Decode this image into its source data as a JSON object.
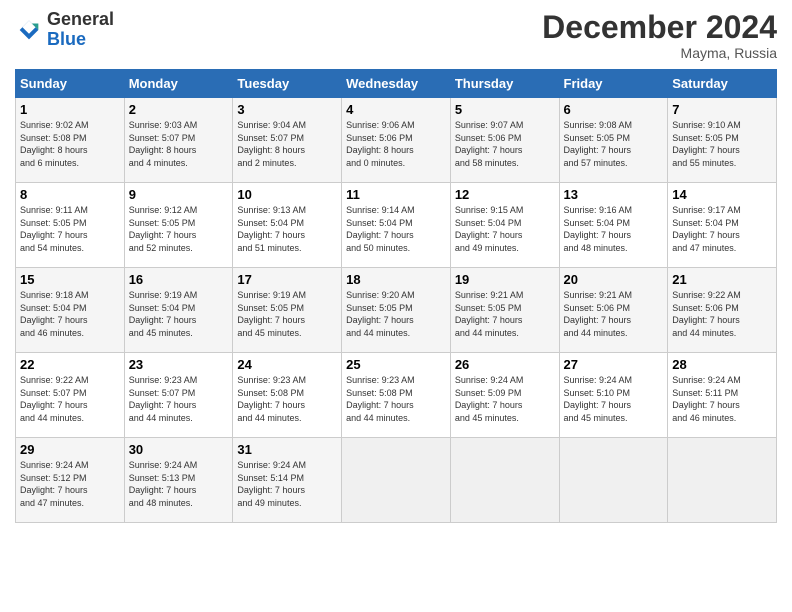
{
  "header": {
    "logo_general": "General",
    "logo_blue": "Blue",
    "month_title": "December 2024",
    "subtitle": "Mayma, Russia"
  },
  "days_of_week": [
    "Sunday",
    "Monday",
    "Tuesday",
    "Wednesday",
    "Thursday",
    "Friday",
    "Saturday"
  ],
  "weeks": [
    [
      {
        "day": "1",
        "info": "Sunrise: 9:02 AM\nSunset: 5:08 PM\nDaylight: 8 hours\nand 6 minutes."
      },
      {
        "day": "2",
        "info": "Sunrise: 9:03 AM\nSunset: 5:07 PM\nDaylight: 8 hours\nand 4 minutes."
      },
      {
        "day": "3",
        "info": "Sunrise: 9:04 AM\nSunset: 5:07 PM\nDaylight: 8 hours\nand 2 minutes."
      },
      {
        "day": "4",
        "info": "Sunrise: 9:06 AM\nSunset: 5:06 PM\nDaylight: 8 hours\nand 0 minutes."
      },
      {
        "day": "5",
        "info": "Sunrise: 9:07 AM\nSunset: 5:06 PM\nDaylight: 7 hours\nand 58 minutes."
      },
      {
        "day": "6",
        "info": "Sunrise: 9:08 AM\nSunset: 5:05 PM\nDaylight: 7 hours\nand 57 minutes."
      },
      {
        "day": "7",
        "info": "Sunrise: 9:10 AM\nSunset: 5:05 PM\nDaylight: 7 hours\nand 55 minutes."
      }
    ],
    [
      {
        "day": "8",
        "info": "Sunrise: 9:11 AM\nSunset: 5:05 PM\nDaylight: 7 hours\nand 54 minutes."
      },
      {
        "day": "9",
        "info": "Sunrise: 9:12 AM\nSunset: 5:05 PM\nDaylight: 7 hours\nand 52 minutes."
      },
      {
        "day": "10",
        "info": "Sunrise: 9:13 AM\nSunset: 5:04 PM\nDaylight: 7 hours\nand 51 minutes."
      },
      {
        "day": "11",
        "info": "Sunrise: 9:14 AM\nSunset: 5:04 PM\nDaylight: 7 hours\nand 50 minutes."
      },
      {
        "day": "12",
        "info": "Sunrise: 9:15 AM\nSunset: 5:04 PM\nDaylight: 7 hours\nand 49 minutes."
      },
      {
        "day": "13",
        "info": "Sunrise: 9:16 AM\nSunset: 5:04 PM\nDaylight: 7 hours\nand 48 minutes."
      },
      {
        "day": "14",
        "info": "Sunrise: 9:17 AM\nSunset: 5:04 PM\nDaylight: 7 hours\nand 47 minutes."
      }
    ],
    [
      {
        "day": "15",
        "info": "Sunrise: 9:18 AM\nSunset: 5:04 PM\nDaylight: 7 hours\nand 46 minutes."
      },
      {
        "day": "16",
        "info": "Sunrise: 9:19 AM\nSunset: 5:04 PM\nDaylight: 7 hours\nand 45 minutes."
      },
      {
        "day": "17",
        "info": "Sunrise: 9:19 AM\nSunset: 5:05 PM\nDaylight: 7 hours\nand 45 minutes."
      },
      {
        "day": "18",
        "info": "Sunrise: 9:20 AM\nSunset: 5:05 PM\nDaylight: 7 hours\nand 44 minutes."
      },
      {
        "day": "19",
        "info": "Sunrise: 9:21 AM\nSunset: 5:05 PM\nDaylight: 7 hours\nand 44 minutes."
      },
      {
        "day": "20",
        "info": "Sunrise: 9:21 AM\nSunset: 5:06 PM\nDaylight: 7 hours\nand 44 minutes."
      },
      {
        "day": "21",
        "info": "Sunrise: 9:22 AM\nSunset: 5:06 PM\nDaylight: 7 hours\nand 44 minutes."
      }
    ],
    [
      {
        "day": "22",
        "info": "Sunrise: 9:22 AM\nSunset: 5:07 PM\nDaylight: 7 hours\nand 44 minutes."
      },
      {
        "day": "23",
        "info": "Sunrise: 9:23 AM\nSunset: 5:07 PM\nDaylight: 7 hours\nand 44 minutes."
      },
      {
        "day": "24",
        "info": "Sunrise: 9:23 AM\nSunset: 5:08 PM\nDaylight: 7 hours\nand 44 minutes."
      },
      {
        "day": "25",
        "info": "Sunrise: 9:23 AM\nSunset: 5:08 PM\nDaylight: 7 hours\nand 44 minutes."
      },
      {
        "day": "26",
        "info": "Sunrise: 9:24 AM\nSunset: 5:09 PM\nDaylight: 7 hours\nand 45 minutes."
      },
      {
        "day": "27",
        "info": "Sunrise: 9:24 AM\nSunset: 5:10 PM\nDaylight: 7 hours\nand 45 minutes."
      },
      {
        "day": "28",
        "info": "Sunrise: 9:24 AM\nSunset: 5:11 PM\nDaylight: 7 hours\nand 46 minutes."
      }
    ],
    [
      {
        "day": "29",
        "info": "Sunrise: 9:24 AM\nSunset: 5:12 PM\nDaylight: 7 hours\nand 47 minutes."
      },
      {
        "day": "30",
        "info": "Sunrise: 9:24 AM\nSunset: 5:13 PM\nDaylight: 7 hours\nand 48 minutes."
      },
      {
        "day": "31",
        "info": "Sunrise: 9:24 AM\nSunset: 5:14 PM\nDaylight: 7 hours\nand 49 minutes."
      },
      {
        "day": "",
        "info": ""
      },
      {
        "day": "",
        "info": ""
      },
      {
        "day": "",
        "info": ""
      },
      {
        "day": "",
        "info": ""
      }
    ]
  ]
}
